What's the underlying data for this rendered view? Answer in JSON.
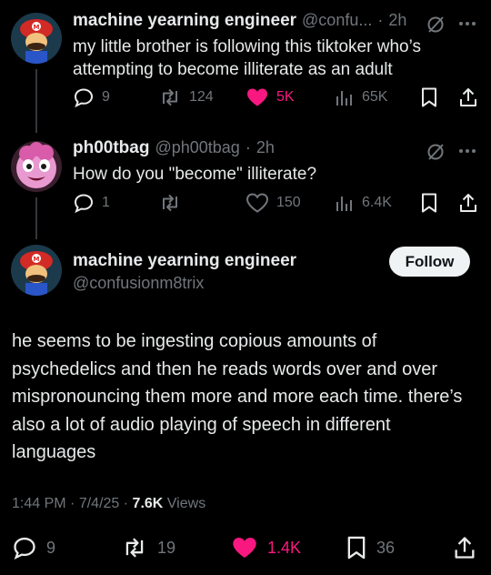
{
  "tweets": [
    {
      "display_name": "machine yearning engineer",
      "handle_short": "@confu...",
      "time": "2h",
      "text_lines": [
        "my little brother is following this tiktoker who’s",
        "attempting to become illiterate as an adult"
      ],
      "replies": "9",
      "reposts": "124",
      "likes": "5K",
      "views": "65K",
      "liked": true
    },
    {
      "display_name": "ph00tbag",
      "handle_short": "@ph00tbag",
      "time": "2h",
      "text_lines": [
        "How do you \"become\" illiterate?"
      ],
      "replies": "1",
      "reposts": "",
      "likes": "150",
      "views": "6.4K",
      "liked": false
    }
  ],
  "main_tweet": {
    "display_name": "machine yearning engineer",
    "handle": "@confusionm8trix",
    "follow_label": "Follow",
    "text": "he seems to be ingesting copious amounts of psychedelics and then he reads words over and over mispronouncing them more and more each time. there’s also a lot of audio playing of speech in different languages",
    "time": "1:44 PM",
    "date": "7/4/25",
    "views_count": "7.6K",
    "views_label": "Views",
    "replies": "9",
    "reposts": "19",
    "likes": "1.4K",
    "bookmarks": "36"
  },
  "separator": "·",
  "colors": {
    "background": "#000000",
    "text_primary": "#e7e9ea",
    "text_secondary": "#71767b",
    "like_pink": "#f91880"
  }
}
